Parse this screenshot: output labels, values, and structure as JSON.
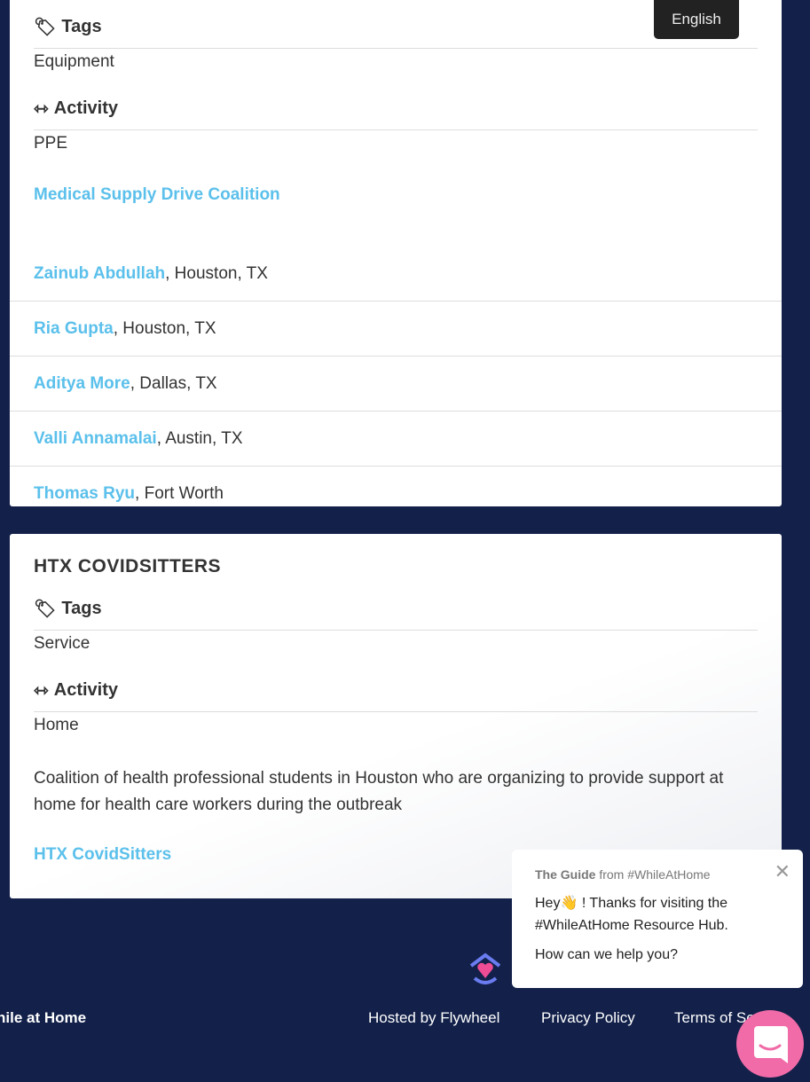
{
  "language": "English",
  "card1": {
    "tags_label": "Tags",
    "tags": "Equipment",
    "activity_label": "Activity",
    "activity": "PPE",
    "link": "Medical Supply Drive Coalition",
    "people": [
      {
        "name": "Zainub Abdullah",
        "loc": ", Houston, TX"
      },
      {
        "name": "Ria Gupta",
        "loc": ", Houston, TX"
      },
      {
        "name": "Aditya More",
        "loc": ", Dallas, TX"
      },
      {
        "name": "Valli Annamalai",
        "loc": ", Austin, TX"
      },
      {
        "name": "Thomas Ryu",
        "loc": ", Fort Worth"
      }
    ]
  },
  "card2": {
    "title": "HTX COVIDSITTERS",
    "tags_label": "Tags",
    "tags": "Service",
    "activity_label": "Activity",
    "activity": "Home",
    "description": "Coalition of health professional students in Houston who are organizing to provide support at home for health care workers during the outbreak",
    "link": "HTX CovidSitters"
  },
  "footer": {
    "site": "hile at Home",
    "hosted": "Hosted by Flywheel",
    "privacy": "Privacy Policy",
    "terms": "Terms of Service"
  },
  "popup": {
    "sender": "The Guide",
    "from": " from #WhileAtHome",
    "line1": "Hey👋 ! Thanks for visiting the #WhileAtHome Resource Hub.",
    "line2": "How can we help you?"
  },
  "colors": {
    "background": "#13214a",
    "link": "#5bc0eb",
    "chat": "#f06ba7"
  }
}
